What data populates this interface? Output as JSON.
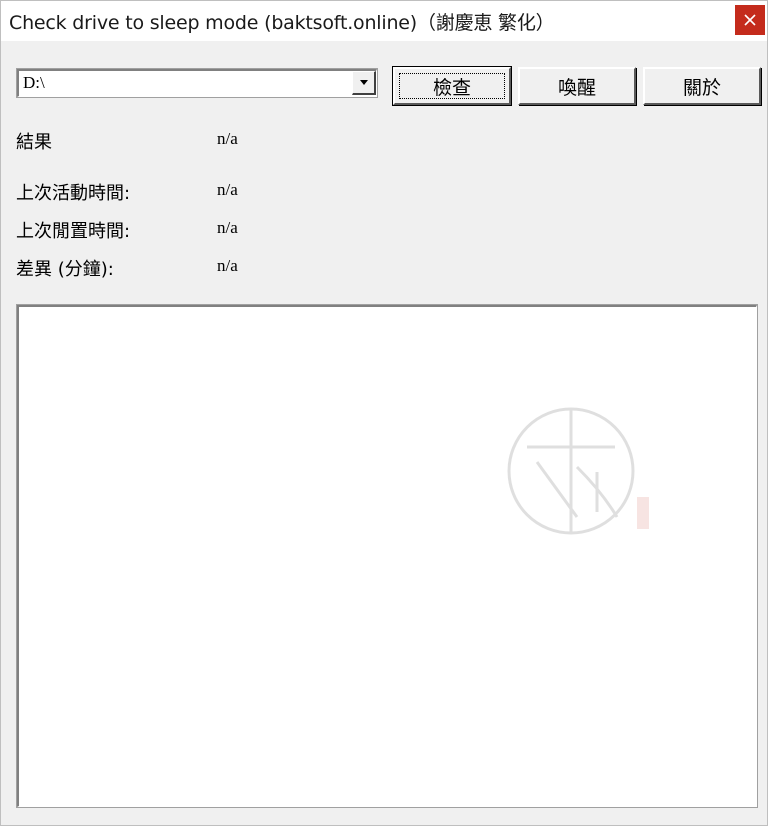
{
  "window": {
    "title": "Check drive to sleep mode (baktsoft.online)（謝慶恵 繁化）"
  },
  "drive_select": {
    "value": "D:\\"
  },
  "buttons": {
    "check": "檢查",
    "wake": "喚醒",
    "about": "關於"
  },
  "fields": [
    {
      "label": "結果",
      "value": "n/a"
    },
    {
      "label": "上次活動時間:",
      "value": "n/a"
    },
    {
      "label": "上次閒置時間:",
      "value": "n/a"
    },
    {
      "label": "差異 (分鐘):",
      "value": "n/a"
    }
  ],
  "log": {
    "content": ""
  },
  "colors": {
    "close_button": "#c42b1c",
    "window_bg": "#f0f0f0"
  },
  "icons": [
    "close-icon",
    "dropdown-arrow-icon",
    "watermark-logo"
  ]
}
